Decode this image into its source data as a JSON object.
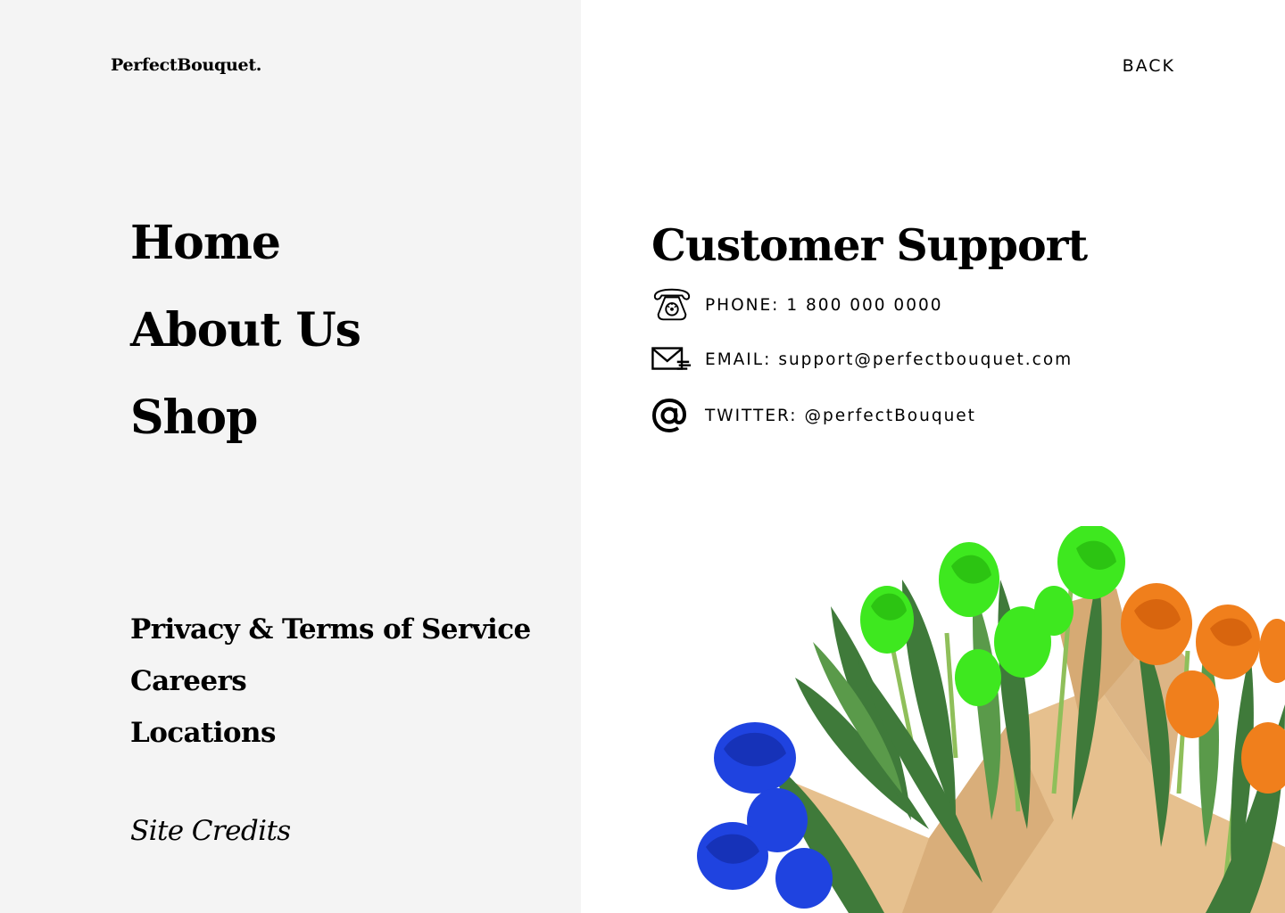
{
  "brand": {
    "logo": "PerfectBouquet."
  },
  "main_nav": [
    {
      "label": "Home"
    },
    {
      "label": "About Us"
    },
    {
      "label": "Shop"
    }
  ],
  "secondary_nav": [
    {
      "label": "Privacy & Terms of Service"
    },
    {
      "label": "Careers"
    },
    {
      "label": "Locations"
    }
  ],
  "site_credits": "Site Credits",
  "back_label": "BACK",
  "support": {
    "title": "Customer Support",
    "contacts": [
      {
        "label": "PHONE:",
        "value": "1 800 000 0000",
        "icon": "telephone-icon"
      },
      {
        "label": "EMAIL:",
        "value": "support@perfectbouquet.com",
        "icon": "envelope-icon"
      },
      {
        "label": "TWITTER:",
        "value": "@perfectBouquet",
        "icon": "at-sign-icon"
      }
    ]
  },
  "colors": {
    "left_panel_bg": "#f4f4f4",
    "right_panel_bg": "#ffffff",
    "text": "#000000",
    "tulip_green": "#3ee81f",
    "tulip_orange": "#f07f1c",
    "tulip_blue": "#1f43e0",
    "leaf": "#3f7a3a",
    "wrapping_paper": "#e6c08e"
  }
}
